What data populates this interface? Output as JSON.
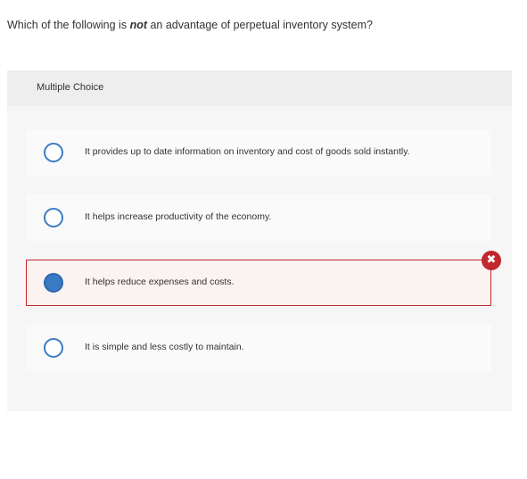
{
  "question": {
    "prefix": "Which of the following is ",
    "emphasis": "not",
    "suffix": " an advantage of perpetual inventory system?"
  },
  "multiple_choice": {
    "header": "Multiple Choice",
    "options": [
      {
        "text": "It provides up to date information on inventory and cost of goods sold instantly.",
        "selected": false
      },
      {
        "text": "It helps increase productivity of the economy.",
        "selected": false
      },
      {
        "text": "It helps reduce expenses and costs.",
        "selected": true,
        "result": "incorrect"
      },
      {
        "text": "It is simple and less costly to maintain.",
        "selected": false
      }
    ],
    "incorrect_icon": "x-icon"
  },
  "colors": {
    "radio_blue": "#3b7cc4",
    "incorrect_red": "#c1272d"
  }
}
